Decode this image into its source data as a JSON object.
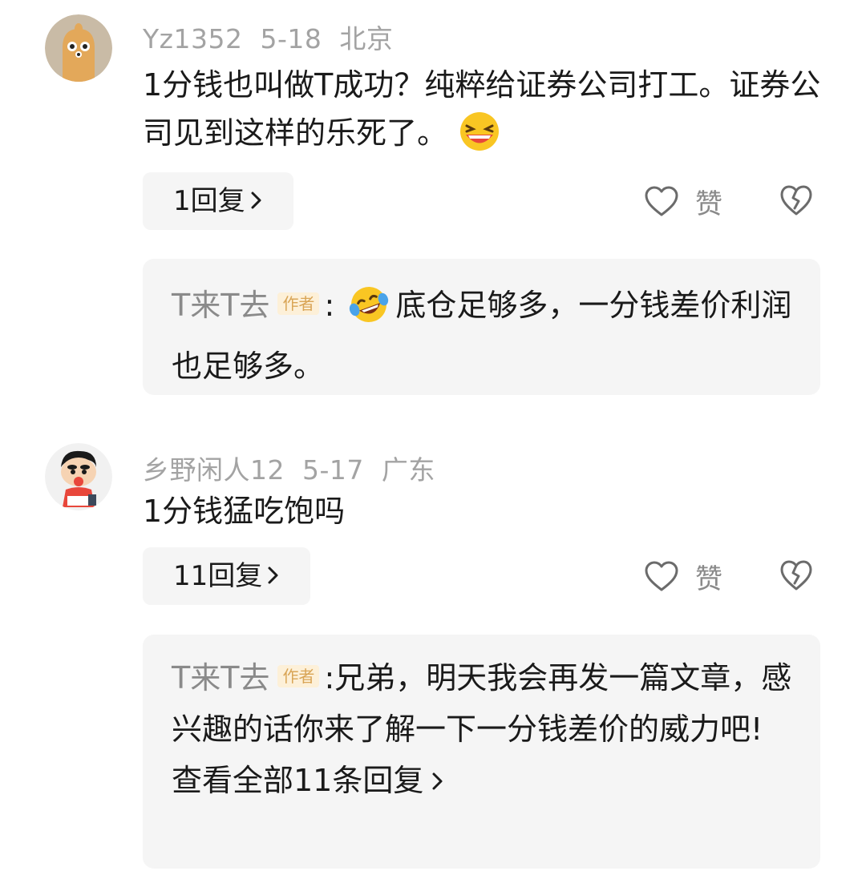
{
  "comments": [
    {
      "username": "Yz1352",
      "date": "5-18",
      "location": "北京",
      "text": "1分钱也叫做T成功？纯粹给证券公司打工。证券公司见到这样的乐死了。",
      "emoji": "grinning-squinting-face",
      "reply_label": "1回复",
      "like_label": "赞",
      "reply": {
        "author": "T来T去",
        "badge": "作者",
        "colon": ":",
        "emoji": "face-with-tears-of-joy",
        "text": "底仓足够多，一分钱差价利润也足够多。"
      }
    },
    {
      "username": "乡野闲人12",
      "date": "5-17",
      "location": "广东",
      "text": "1分钱猛吃饱吗",
      "reply_label": "11回复",
      "like_label": "赞",
      "reply": {
        "author": "T来T去",
        "badge": "作者",
        "colon": ":",
        "text": "兄弟，明天我会再发一篇文章，感兴趣的话你来了解一下一分钱差价的威力吧!",
        "view_all": "查看全部11条回复"
      }
    }
  ],
  "colors": {
    "meta_gray": "#a3a3a3",
    "panel_bg": "#f5f5f5",
    "badge_bg": "#fdf0d8",
    "badge_text": "#d9a556"
  }
}
